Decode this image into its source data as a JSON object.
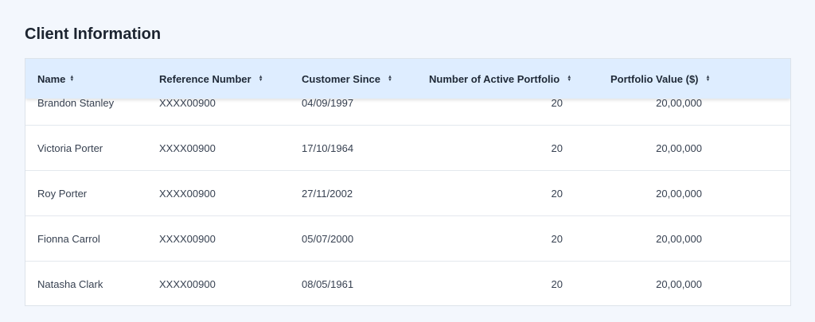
{
  "page": {
    "title": "Client Information"
  },
  "table": {
    "columns": [
      "Name",
      "Reference Number",
      "Customer Since",
      "Number of Active Portfolio",
      "Portfolio Value ($)"
    ],
    "rows": [
      [
        "Brandon Stanley",
        "XXXX00900",
        "04/09/1997",
        "20",
        "20,00,000"
      ],
      [
        "Victoria Porter",
        "XXXX00900",
        "17/10/1964",
        "20",
        "20,00,000"
      ],
      [
        "Roy Porter",
        "XXXX00900",
        "27/11/2002",
        "20",
        "20,00,000"
      ],
      [
        "Fionna Carrol",
        "XXXX00900",
        "05/07/2000",
        "20",
        "20,00,000"
      ],
      [
        "Natasha Clark",
        "XXXX00900",
        "08/05/1961",
        "20",
        "20,00,000"
      ]
    ]
  },
  "icons": {
    "sort": "sort-updown-icon"
  },
  "colors": {
    "header_bg": "#deedff",
    "page_bg": "#f3f7fd"
  }
}
